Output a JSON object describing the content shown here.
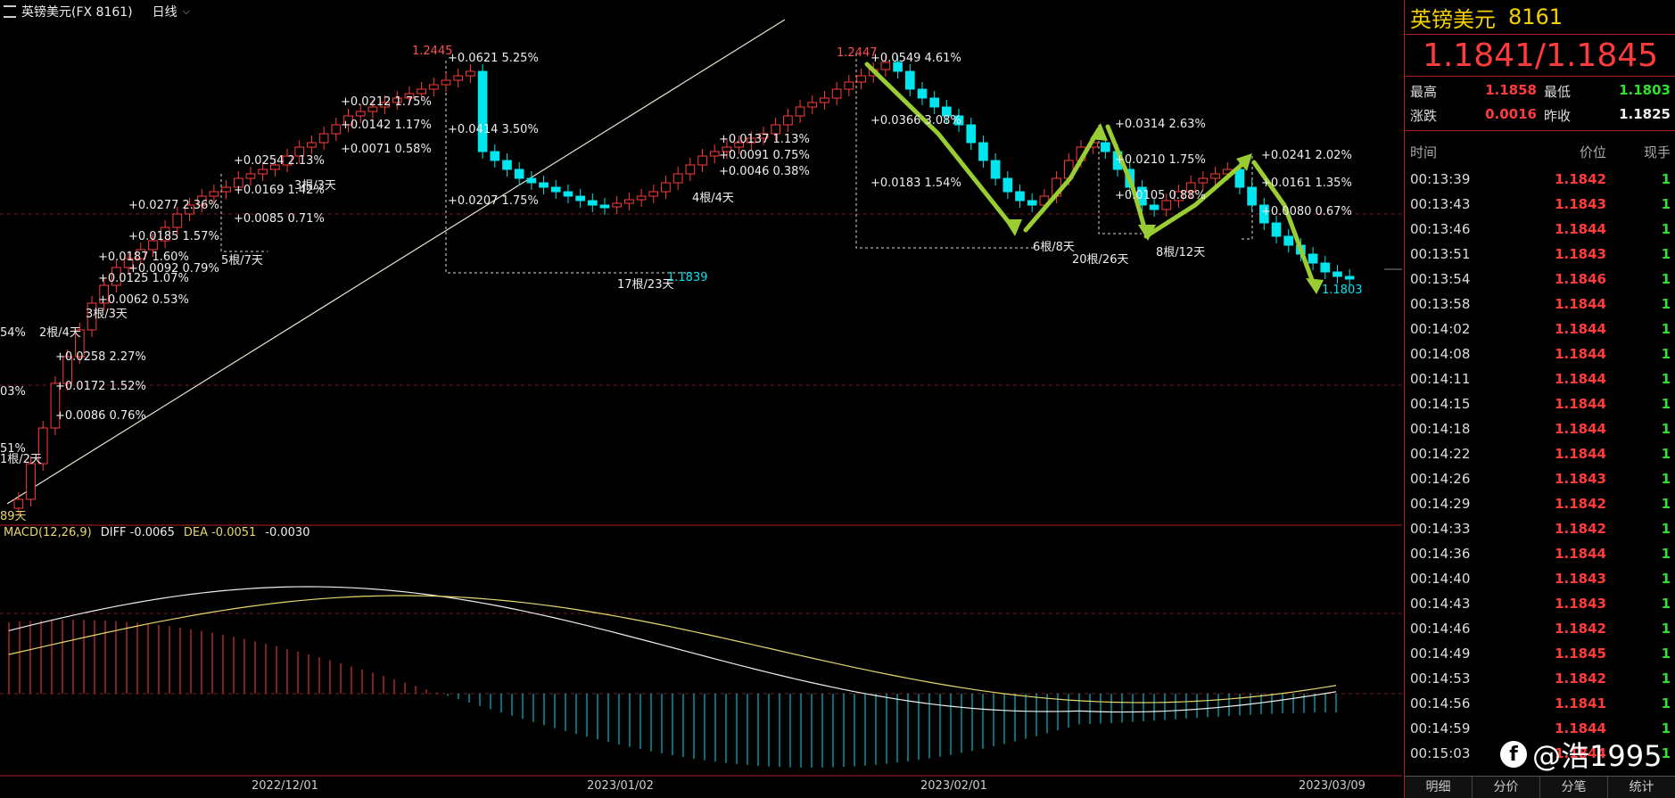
{
  "header": {
    "symbol": "英镑美元(FX 8161)",
    "period": "日线"
  },
  "macd": {
    "label": "MACD(12,26,9)",
    "diff": "DIFF -0.0065",
    "dea": "DEA -0.0051",
    "hist": "-0.0030"
  },
  "x_axis": [
    "2022/12/01",
    "2023/01/02",
    "2023/02/01",
    "2023/03/09"
  ],
  "annotations": {
    "high1": "1.2445",
    "high2": "1.2447",
    "low1": "1.1839",
    "low2": "1.1803",
    "lab1": "+0.0621  5.25%",
    "lab2": "+0.0414  3.50%",
    "lab3": "+0.0207  1.75%",
    "lab4": "+0.0549  4.61%",
    "lab5": "+0.0366  3.08%",
    "lab6": "+0.0183  1.54%",
    "lab7": "+0.0314  2.63%",
    "lab8": "+0.0210  1.75%",
    "lab9": "+0.0105  0.88%",
    "lab10": "+0.0241  2.02%",
    "lab11": "+0.0161  1.35%",
    "lab12": "+0.0080  0.67%",
    "lab13": "+0.0277  2.36%",
    "lab14": "+0.0185  1.57%",
    "lab15": "+0.0092  0.79%",
    "lab16": "+0.0254  2.13%",
    "lab17": "+0.0169  1.42%",
    "lab18": "+0.0085  0.71%",
    "lab19": "+0.0212  1.75%",
    "lab20": "+0.0142  1.17%",
    "lab21": "+0.0071  0.58%",
    "lab22": "+0.0258  2.27%",
    "lab23": "+0.0172  1.52%",
    "lab24": "+0.0086  0.76%",
    "lab25": "+0.0187  1.60%",
    "lab26": "+0.0125  1.07%",
    "lab27": "+0.0062  0.53%",
    "lab28": "+0.0137  1.13%",
    "lab29": "+0.0091  0.75%",
    "lab30": "+0.0046  0.38%",
    "cnt1": "17根/23天",
    "cnt2": "6根/8天",
    "cnt3": "20根/26天",
    "cnt4": "8根/12天",
    "cnt5": "5根/7天",
    "cnt6": "3根/3天",
    "cnt7": "2根/4天",
    "cnt8": "4根/4天",
    "cnt9": "3根/3天",
    "cnt10": "1根/2天",
    "cnt11": "89天",
    "edge1": "54%",
    "edge2": "03%",
    "edge3": "51%"
  },
  "quote": {
    "name": "英镑美元",
    "code": "8161",
    "bid": "1.1841",
    "ask": "1.1845",
    "high_label": "最高",
    "high": "1.1858",
    "low_label": "最低",
    "low": "1.1803",
    "chg_label": "涨跌",
    "chg": "0.0016",
    "prev_label": "昨收",
    "prev": "1.1825",
    "col_time": "时间",
    "col_price": "价位",
    "col_vol": "现手",
    "ticks": [
      {
        "t": "00:13:39",
        "p": "1.1842",
        "v": "1"
      },
      {
        "t": "00:13:43",
        "p": "1.1843",
        "v": "1"
      },
      {
        "t": "00:13:46",
        "p": "1.1844",
        "v": "1"
      },
      {
        "t": "00:13:51",
        "p": "1.1843",
        "v": "1"
      },
      {
        "t": "00:13:54",
        "p": "1.1846",
        "v": "1"
      },
      {
        "t": "00:13:58",
        "p": "1.1844",
        "v": "1"
      },
      {
        "t": "00:14:02",
        "p": "1.1844",
        "v": "1"
      },
      {
        "t": "00:14:08",
        "p": "1.1844",
        "v": "1"
      },
      {
        "t": "00:14:11",
        "p": "1.1844",
        "v": "1"
      },
      {
        "t": "00:14:15",
        "p": "1.1844",
        "v": "1"
      },
      {
        "t": "00:14:18",
        "p": "1.1844",
        "v": "1"
      },
      {
        "t": "00:14:22",
        "p": "1.1844",
        "v": "1"
      },
      {
        "t": "00:14:26",
        "p": "1.1843",
        "v": "1"
      },
      {
        "t": "00:14:29",
        "p": "1.1842",
        "v": "1"
      },
      {
        "t": "00:14:33",
        "p": "1.1842",
        "v": "1"
      },
      {
        "t": "00:14:36",
        "p": "1.1844",
        "v": "1"
      },
      {
        "t": "00:14:40",
        "p": "1.1843",
        "v": "1"
      },
      {
        "t": "00:14:43",
        "p": "1.1843",
        "v": "1"
      },
      {
        "t": "00:14:46",
        "p": "1.1842",
        "v": "1"
      },
      {
        "t": "00:14:49",
        "p": "1.1845",
        "v": "1"
      },
      {
        "t": "00:14:53",
        "p": "1.1842",
        "v": "1"
      },
      {
        "t": "00:14:56",
        "p": "1.1841",
        "v": "1"
      },
      {
        "t": "00:14:59",
        "p": "1.1844",
        "v": "1"
      },
      {
        "t": "00:15:03",
        "p": "1.1844",
        "v": "1"
      }
    ],
    "tabs": [
      "明细",
      "分价",
      "分笔",
      "统计"
    ]
  },
  "watermark": {
    "logo": "f",
    "text": "@浩1995"
  },
  "colors": {
    "up": "#ff3b3b",
    "down": "#00e5ee",
    "arrow": "#9acd32",
    "grid": "#7a1a1a"
  }
}
